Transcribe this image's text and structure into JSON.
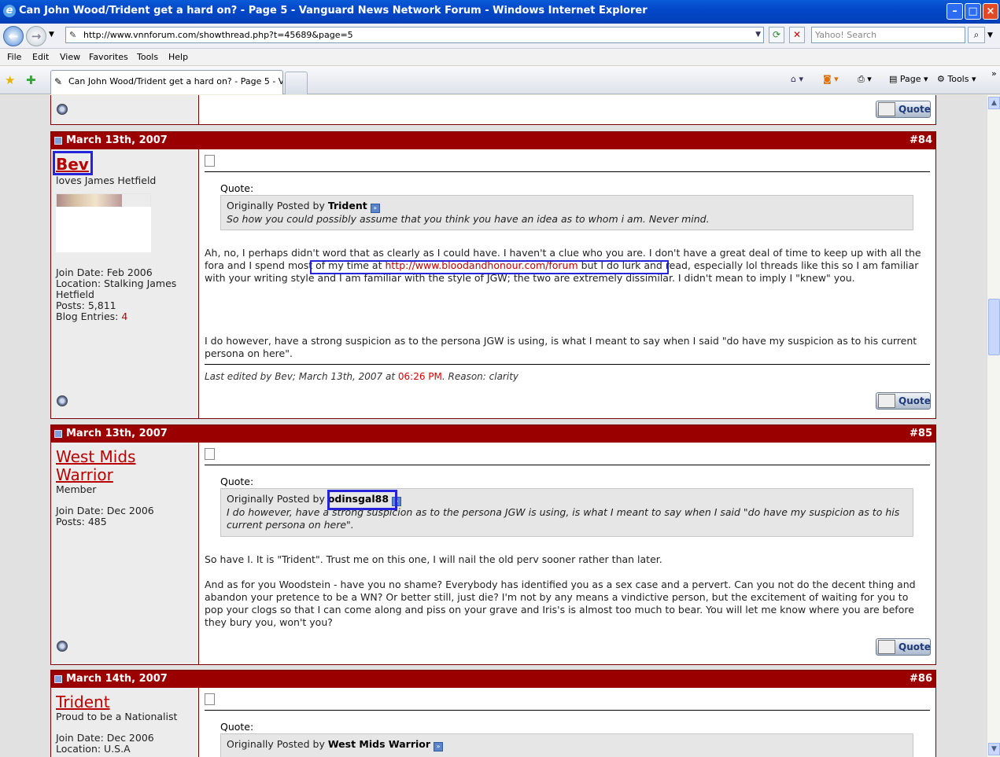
{
  "window": {
    "title": "Can John Wood/Trident get a hard on? - Page 5 - Vanguard News Network Forum - Windows Internet Explorer"
  },
  "address": {
    "url": "http://www.vnnforum.com/showthread.php?t=45689&page=5",
    "search_placeholder": "Yahoo! Search"
  },
  "menu": [
    "File",
    "Edit",
    "View",
    "Favorites",
    "Tools",
    "Help"
  ],
  "tab": {
    "label": "Can John Wood/Trident get a hard on? - Page 5 - Van..."
  },
  "toolbar": {
    "page_label": "Page",
    "tools_label": "Tools"
  },
  "quote_button_label": "Quote",
  "posts": [
    {
      "date": "March 13th, 2007",
      "number": "#84",
      "username": "Bev",
      "user_title": "loves James Hetfield",
      "join_date": "Join Date: Feb 2006",
      "location": "Location: Stalking James Hetfield",
      "posts": "Posts: 5,811",
      "blog_label": "Blog Entries: ",
      "blog_count": "4",
      "quote_label": "Quote:",
      "quote_prefix": "Originally Posted by ",
      "quote_author": "Trident",
      "quote_text": "So how you could possibly assume that you think you have an idea as to whom i am. Never mind.",
      "body_p1_a": "Ah, no, I perhaps didn't word that as clearly as I could have. I haven't a clue who you are. I don't have a great deal of time to keep up with all the fora and ",
      "body_p1_b": "I spend most of my time at ",
      "body_p1_link": "http://www.bloodandhonour.com/forum",
      "body_p1_c": " but I do lurk and read, especially lol threads like this so I am familiar with your writing style and I am familiar with the style of JGW; the two are extremely dissimilar. I didn't mean to imply I \"knew\" you.",
      "body_p2": "I do however, have a strong suspicion as to the persona JGW is using, is what I meant to say when I said \"do have my suspicion as to his current persona on here\".",
      "edit_prefix": "Last edited by Bev; March 13th, 2007 at ",
      "edit_time": "06:26 PM",
      "edit_suffix": ". Reason: clarity"
    },
    {
      "date": "March 13th, 2007",
      "number": "#85",
      "username": "West Mids Warrior",
      "username_line1": "West Mids",
      "username_line2": "Warrior",
      "user_title": "Member",
      "join_date": "Join Date: Dec 2006",
      "posts": "Posts: 485",
      "quote_label": "Quote:",
      "quote_prefix": "Originally Posted by ",
      "quote_author": "odinsgal88",
      "quote_text": "I do however, have a strong suspicion as to the persona JGW is using, is what I meant to say when I said \"do have my suspicion as to his current persona on here\".",
      "body_p1": "So have I. It is \"Trident\". Trust me on this one, I will nail the old perv sooner rather than later.",
      "body_p2": "And as for you Woodstein - have you no shame? Everybody has identified you as a sex case and a pervert. Can you not do the decent thing and abandon your pretence to be a WN? Or better still, just die? I'm not by any means a vindictive person, but the excitement of waiting for you to pop your clogs so that I can come along and piss on your grave and Iris's is almost too much to bear. You will let me know where you are before they bury you, won't you?"
    },
    {
      "date": "March 14th, 2007",
      "number": "#86",
      "username": "Trident",
      "user_title": "Proud to be a Nationalist",
      "join_date": "Join Date: Dec 2006",
      "location": "Location: U.S.A",
      "quote_label": "Quote:",
      "quote_prefix": "Originally Posted by ",
      "quote_author": "West Mids Warrior"
    }
  ]
}
